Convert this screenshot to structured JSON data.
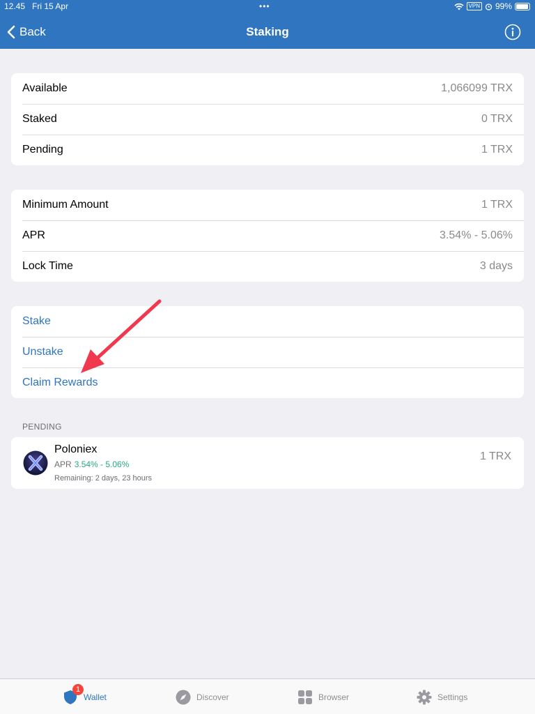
{
  "status_bar": {
    "time": "12.45",
    "date": "Fri 15 Apr",
    "dots": "•••",
    "vpn": "VPN",
    "battery": "99%"
  },
  "nav": {
    "back_label": "Back",
    "title": "Staking"
  },
  "balances": [
    {
      "label": "Available",
      "value": "1,066099 TRX"
    },
    {
      "label": "Staked",
      "value": "0 TRX"
    },
    {
      "label": "Pending",
      "value": "1 TRX"
    }
  ],
  "details": [
    {
      "label": "Minimum Amount",
      "value": "1 TRX"
    },
    {
      "label": "APR",
      "value": "3.54% - 5.06%"
    },
    {
      "label": "Lock Time",
      "value": "3 days"
    }
  ],
  "actions": [
    "Stake",
    "Unstake",
    "Claim Rewards"
  ],
  "pending_section": {
    "label": "PENDING",
    "validator": {
      "name": "Poloniex",
      "apr_label": "APR",
      "apr_value": "3.54% - 5.06%",
      "remaining": "Remaining: 2 days, 23 hours",
      "amount": "1 TRX",
      "logo_icon": "poloniex-x-logo"
    }
  },
  "tabs": [
    {
      "label": "Wallet",
      "icon": "shield-icon",
      "badge": "1",
      "active": true
    },
    {
      "label": "Discover",
      "icon": "compass-icon"
    },
    {
      "label": "Browser",
      "icon": "grid-icon"
    },
    {
      "label": "Settings",
      "icon": "gear-icon"
    }
  ],
  "colors": {
    "accent": "#2f75c0",
    "apr_green": "#27a882",
    "badge_red": "#f5453b",
    "arrow_red": "#f0394f"
  }
}
